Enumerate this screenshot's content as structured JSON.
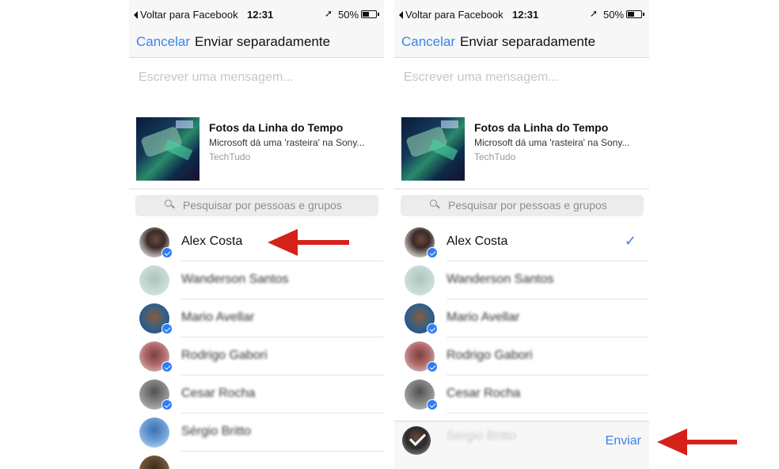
{
  "screens": [
    {
      "statusbar": {
        "back": "Voltar para Facebook",
        "time": "12:31",
        "battery": "50%"
      },
      "nav": {
        "cancel": "Cancelar",
        "title": "Enviar separadamente"
      },
      "message_placeholder": "Escrever uma mensagem...",
      "preview": {
        "title": "Fotos da Linha do Tempo",
        "subtitle": "Microsoft dá uma 'rasteira' na Sony...",
        "source": "TechTudo"
      },
      "search_placeholder": "Pesquisar por pessoas e grupos",
      "contacts": [
        {
          "name": "Alex Costa",
          "selected": false
        },
        {
          "name": "Wanderson Santos",
          "selected": false
        },
        {
          "name": "Mario Avellar",
          "selected": false
        },
        {
          "name": "Rodrigo Gabori",
          "selected": false
        },
        {
          "name": "Cesar Rocha",
          "selected": false
        },
        {
          "name": "Sérgio Britto",
          "selected": false
        }
      ]
    },
    {
      "statusbar": {
        "back": "Voltar para Facebook",
        "time": "12:31",
        "battery": "50%"
      },
      "nav": {
        "cancel": "Cancelar",
        "title": "Enviar separadamente"
      },
      "message_placeholder": "Escrever uma mensagem...",
      "preview": {
        "title": "Fotos da Linha do Tempo",
        "subtitle": "Microsoft dá uma 'rasteira' na Sony...",
        "source": "TechTudo"
      },
      "search_placeholder": "Pesquisar por pessoas e grupos",
      "contacts": [
        {
          "name": "Alex Costa",
          "selected": true,
          "checkmark": "✓"
        },
        {
          "name": "Wanderson Santos",
          "selected": false
        },
        {
          "name": "Mario Avellar",
          "selected": false
        },
        {
          "name": "Rodrigo Gabori",
          "selected": false
        },
        {
          "name": "Cesar Rocha",
          "selected": false
        },
        {
          "name": "Sérgio Britto",
          "selected": false
        }
      ],
      "send_bar": {
        "send_label": "Enviar"
      }
    }
  ],
  "colors": {
    "accent": "#3b84e8",
    "annotation_arrow": "#d4211a",
    "badge": "#2e7df6"
  },
  "icons": [
    "back-arrow-icon",
    "location-arrow-icon",
    "battery-icon",
    "search-icon",
    "messenger-badge-icon",
    "checkmark-icon",
    "red-arrow-annotation"
  ]
}
